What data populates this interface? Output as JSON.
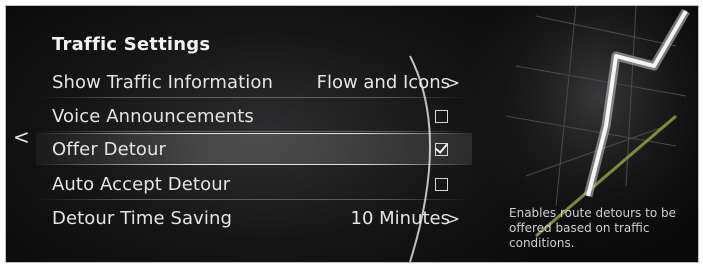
{
  "menu": {
    "title": "Traffic Settings",
    "rows": [
      {
        "label": "Show Traffic Information",
        "value": "Flow and Icons",
        "control": "chevron"
      },
      {
        "label": "Voice Announcements",
        "checked": false,
        "control": "checkbox"
      },
      {
        "label": "Offer Detour",
        "checked": true,
        "control": "checkbox",
        "selected": true
      },
      {
        "label": "Auto Accept Detour",
        "checked": false,
        "control": "checkbox"
      },
      {
        "label": "Detour Time Saving",
        "value": "10 Minutes",
        "control": "chevron"
      }
    ],
    "chevron_glyph": ">",
    "back_glyph": "<"
  },
  "help_text": "Enables route detours to be offered based on traffic conditions.",
  "icons": {
    "back": "chevron-left-icon",
    "row_chevron": "chevron-right-icon",
    "checkbox": "checkbox-icon"
  },
  "colors": {
    "background": "#111112",
    "text": "#e4e4e4",
    "highlight": "#ffffff",
    "route": "#f4f4f4",
    "road": "#8a9a3a"
  }
}
